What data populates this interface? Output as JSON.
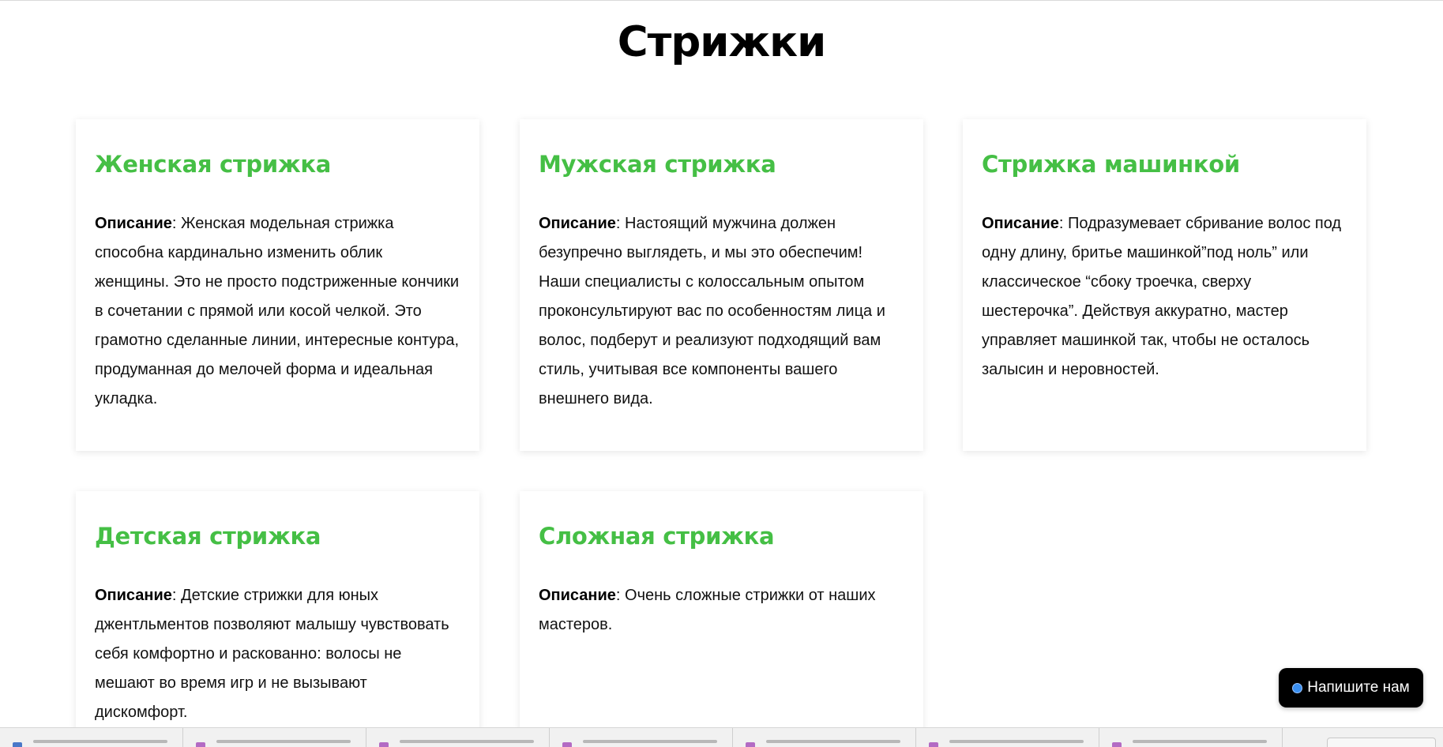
{
  "page": {
    "title": "Стрижки"
  },
  "services": [
    {
      "title": "Женская стрижка",
      "desc_label": "Описание",
      "desc_text": ": Женская модельная стрижка способна кардинально изменить облик женщины. Это не просто подстриженные кончики в сочетании с прямой или косой челкой. Это грамотно сделанные линии, интересные контура, продуманная до мелочей форма и идеальная укладка."
    },
    {
      "title": "Мужская стрижка",
      "desc_label": "Описание",
      "desc_text": ": Настоящий мужчина должен безупречно выглядеть, и мы это обеспечим! Наши специалисты с колоссальным опытом проконсультируют вас по особенностям лица и волос, подберут и реализуют подходящий вам стиль, учитывая все компоненты вашего внешнего вида."
    },
    {
      "title": "Стрижка машинкой",
      "desc_label": "Описание",
      "desc_text": ": Подразумевает сбривание волос под одну длину, бритье машинкой”под ноль” или классическое “сбоку троечка, сверху шестерочка”. Действуя аккуратно, мастер управляет машинкой так, чтобы не осталось залысин и неровностей."
    },
    {
      "title": "Детская стрижка",
      "desc_label": "Описание",
      "desc_text": ": Детские стрижки для юных джентльментов позволяют малышу чувствовать себя комфортно и раскованно: волосы не мешают во время игр и не вызывают дискомфорт."
    },
    {
      "title": "Сложная стрижка",
      "desc_label": "Описание",
      "desc_text": ": Очень сложные стрижки от наших мастеров."
    }
  ],
  "chat": {
    "label": "Напишите нам",
    "dot_color": "#3a8ff0"
  },
  "colors": {
    "accent_green": "#45bf45",
    "chat_background": "#000000"
  },
  "downloads_bar": {
    "items": [
      {
        "icon": "document-file-icon"
      },
      {
        "icon": "image-file-icon"
      },
      {
        "icon": "image-file-icon"
      },
      {
        "icon": "image-file-icon"
      },
      {
        "icon": "image-file-icon"
      },
      {
        "icon": "image-file-icon"
      },
      {
        "icon": "image-file-icon"
      }
    ]
  }
}
